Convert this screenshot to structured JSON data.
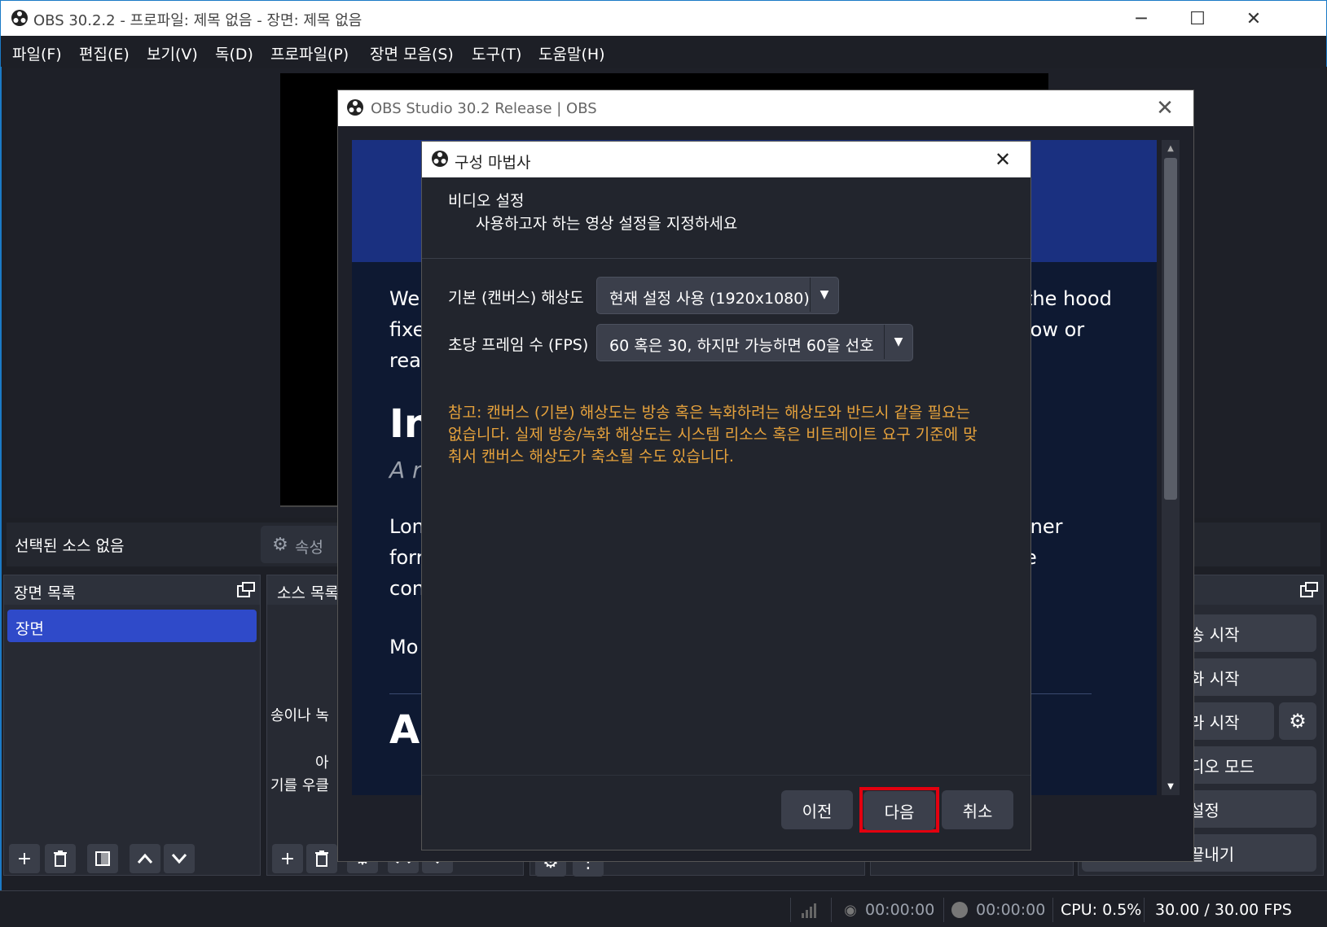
{
  "window": {
    "title": "OBS 30.2.2 - 프로파일: 제목 없음 - 장면: 제목 없음",
    "controls": [
      "─",
      "☐",
      "✕"
    ]
  },
  "menu": [
    "파일(F)",
    "편집(E)",
    "보기(V)",
    "독(D)",
    "프로파일(P)",
    "장면 모음(S)",
    "도구(T)",
    "도움말(H)"
  ],
  "source_bar": {
    "no_source": "선택된 소스 없음",
    "properties": "속성"
  },
  "scenes_dock": {
    "title": "장면 목록",
    "items": [
      "장면"
    ]
  },
  "sources_dock": {
    "title": "소스 목록",
    "hint_line1": "송이나 녹",
    "hint_line2": "아",
    "hint_line3": "기를 우클"
  },
  "controls_dock": {
    "buttons": [
      "송 시작",
      "화 시작",
      "라 시작",
      "디오 모드",
      "설정",
      "끝내기"
    ]
  },
  "statusbar": {
    "stream_time": "00:00:00",
    "record_time": "00:00:00",
    "cpu": "CPU: 0.5%",
    "fps": "30.00 / 30.00 FPS"
  },
  "about_dialog": {
    "title": "OBS Studio 30.2 Release | OBS",
    "fragments": {
      "l1a": "Wel",
      "l1b": "the hood",
      "l2a": "fixe",
      "l2b": "low or",
      "l3a": "rea",
      "h1": "In",
      "sub": "A r",
      "l4a": "Lon",
      "l4b": "iner",
      "l5a": "forr",
      "l5b": "e",
      "l6a": "con",
      "l7a": "Mo",
      "h2": "A"
    }
  },
  "wizard": {
    "title": "구성 마법사",
    "header_title": "비디오 설정",
    "header_subtitle": "사용하고자 하는 영상 설정을 지정하세요",
    "canvas_label": "기본 (캔버스) 해상도",
    "canvas_value": "현재 설정 사용 (1920x1080)",
    "fps_label": "초당 프레임 수 (FPS)",
    "fps_value": "60 혹은 30, 하지만 가능하면 60을 선호",
    "note": "참고: 캔버스 (기본) 해상도는 방송 혹은 녹화하려는 해상도와 반드시 같을 필요는 없습니다. 실제 방송/녹화 해상도는 시스템 리소스 혹은 비트레이트 요구 기준에 맞춰서 캔버스 해상도가 축소될 수도 있습니다.",
    "back": "이전",
    "next": "다음",
    "cancel": "취소"
  },
  "colors": {
    "accent": "#2f4ac9",
    "note": "#e6a23c",
    "highlight": "#e3000f"
  }
}
